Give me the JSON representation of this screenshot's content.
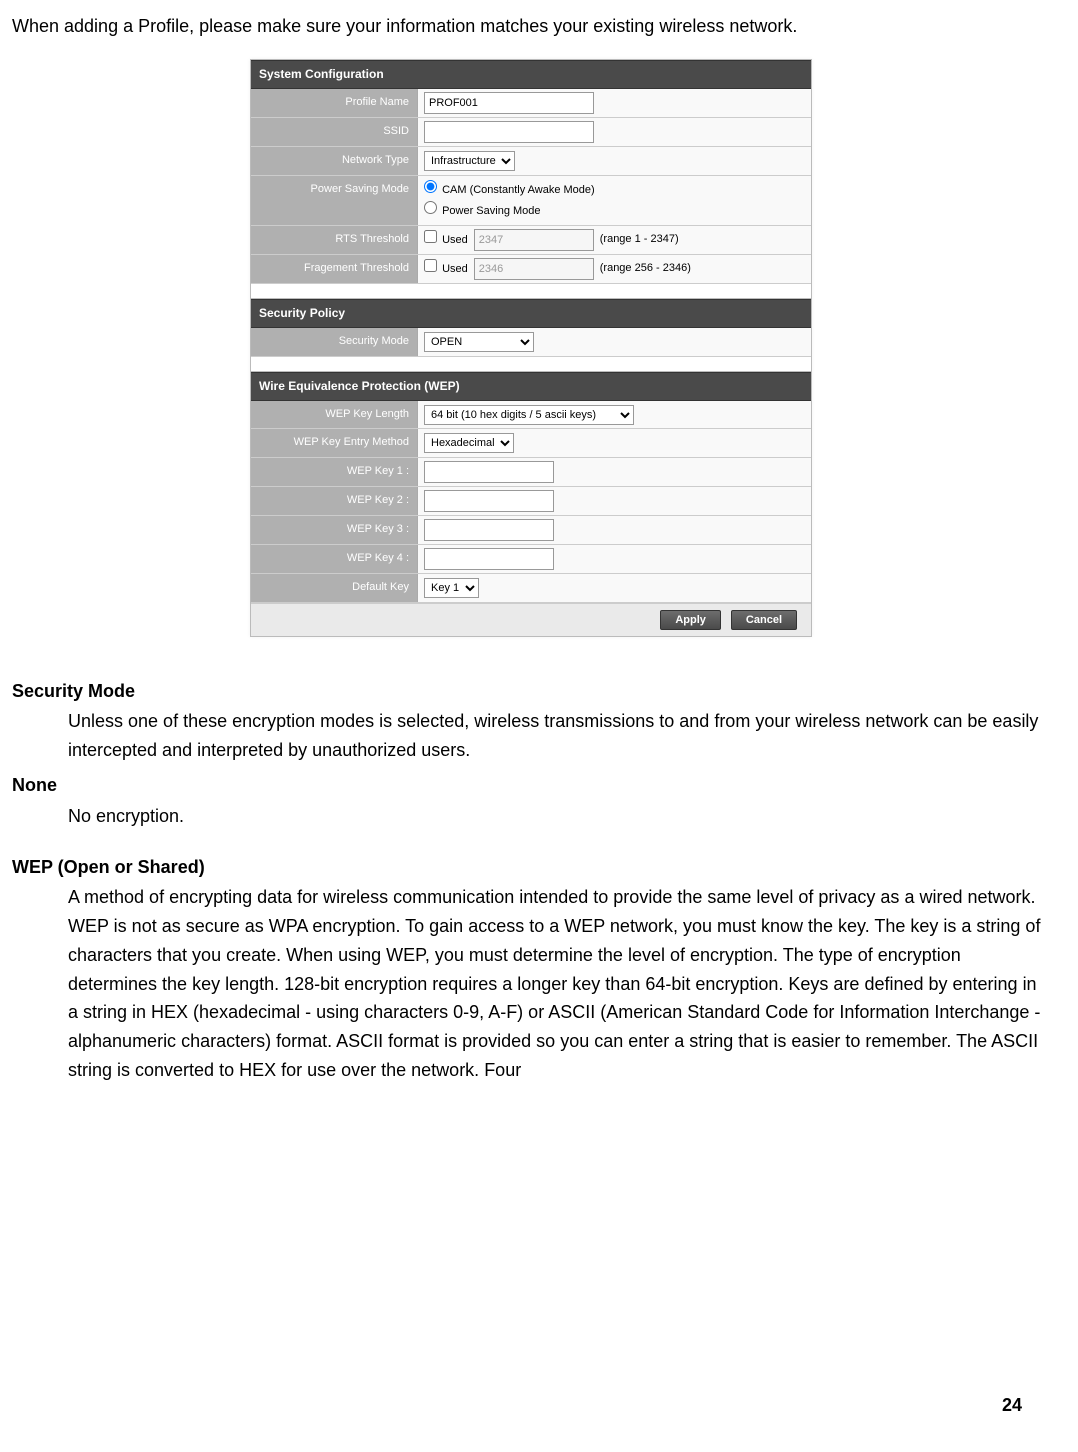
{
  "intro": "When adding a Profile, please make sure your information matches your existing wireless network.",
  "sys": {
    "header": "System Configuration",
    "profile_name_lbl": "Profile Name",
    "profile_name_val": "PROF001",
    "ssid_lbl": "SSID",
    "ssid_val": "",
    "network_type_lbl": "Network Type",
    "network_type_val": "Infrastructure",
    "power_lbl": "Power Saving Mode",
    "power_cam": "CAM (Constantly Awake Mode)",
    "power_psm": "Power Saving Mode",
    "rts_lbl": "RTS Threshold",
    "rts_used": "Used",
    "rts_val": "2347",
    "rts_range": "(range 1 - 2347)",
    "frag_lbl": "Fragement Threshold",
    "frag_used": "Used",
    "frag_val": "2346",
    "frag_range": "(range 256 - 2346)"
  },
  "sec": {
    "header": "Security Policy",
    "mode_lbl": "Security Mode",
    "mode_val": "OPEN"
  },
  "wep": {
    "header": "Wire Equivalence Protection (WEP)",
    "len_lbl": "WEP Key Length",
    "len_val": "64 bit (10 hex digits / 5 ascii keys)",
    "entry_lbl": "WEP Key Entry Method",
    "entry_val": "Hexadecimal",
    "k1": "WEP Key 1 :",
    "k2": "WEP Key 2 :",
    "k3": "WEP Key 3 :",
    "k4": "WEP Key 4 :",
    "def_lbl": "Default Key",
    "def_val": "Key 1"
  },
  "buttons": {
    "apply": "Apply",
    "cancel": "Cancel"
  },
  "doc": {
    "secmode_h": "Security Mode",
    "secmode_b": "Unless one of these encryption modes is selected, wireless transmissions to and from your wireless network can be easily intercepted and interpreted by unauthorized users.",
    "none_h": "None",
    "none_b": "No encryption.",
    "wep_h": "WEP (Open or Shared)",
    "wep_b": "A method of encrypting data for wireless communication intended to provide the same level of privacy as a wired network. WEP is not as secure as WPA encryption. To gain access to a WEP network, you must know the key. The key is a string of characters that you create. When using WEP, you must determine the level of encryption. The type of encryption determines the key length. 128-bit encryption requires a longer key than 64-bit encryption. Keys are defined by entering in a string in HEX (hexadecimal - using characters 0-9, A-F) or ASCII (American Standard Code for Information Interchange - alphanumeric characters) format. ASCII format is provided so you can enter a string that is easier to remember. The ASCII string is converted to HEX for use over the network. Four"
  },
  "page": "24"
}
